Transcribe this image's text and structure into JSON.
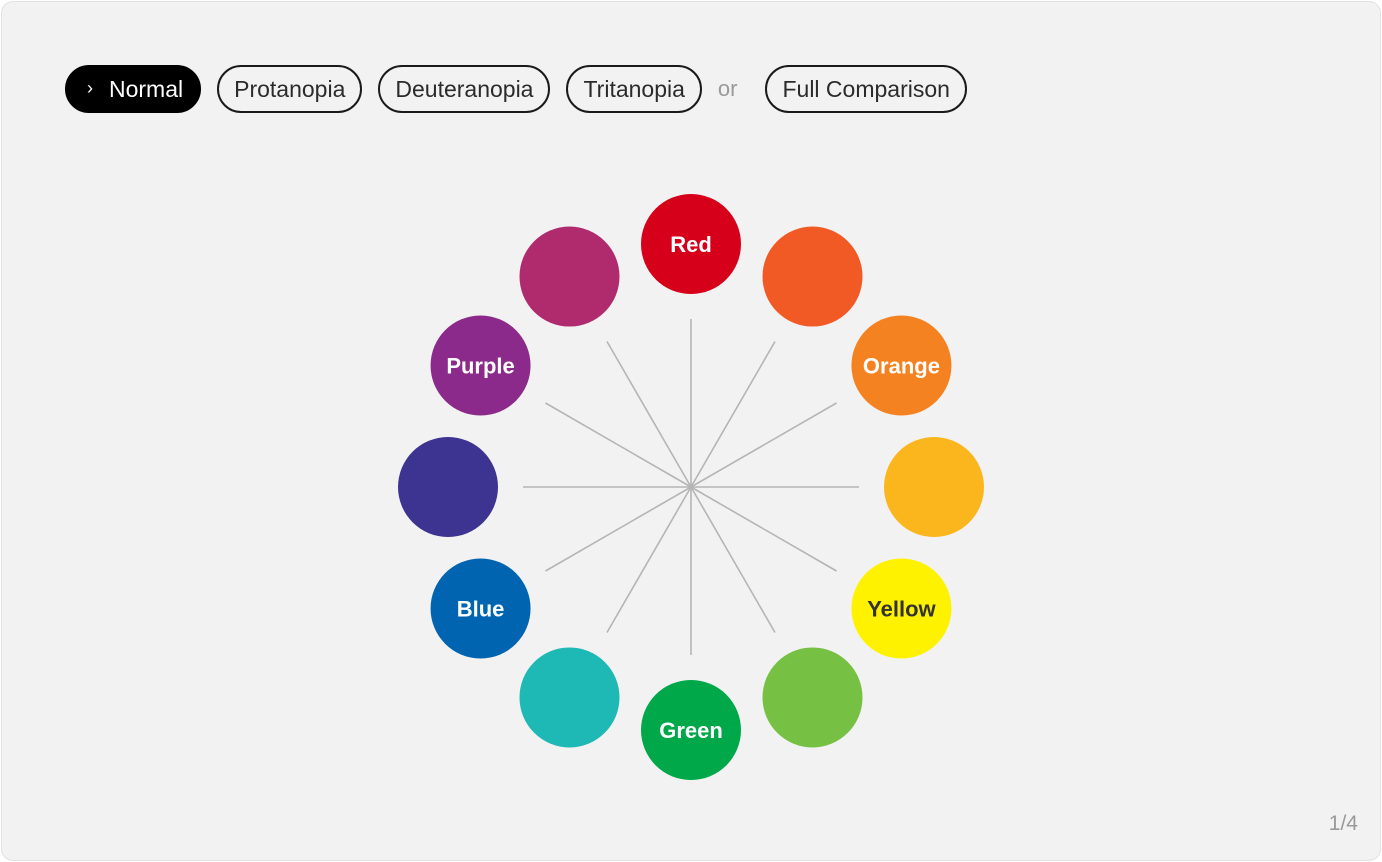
{
  "modes": {
    "buttons": [
      {
        "label": "Normal",
        "active": true
      },
      {
        "label": "Protanopia",
        "active": false
      },
      {
        "label": "Deuteranopia",
        "active": false
      },
      {
        "label": "Tritanopia",
        "active": false
      }
    ],
    "separator": "or",
    "comparison_label": "Full Comparison"
  },
  "wheel": {
    "swatches": [
      {
        "label": "Red",
        "color": "#d7001a",
        "text_color": "#ffffff"
      },
      {
        "label": "",
        "color": "#f15a24",
        "text_color": "#ffffff"
      },
      {
        "label": "Orange",
        "color": "#f58220",
        "text_color": "#ffffff"
      },
      {
        "label": "",
        "color": "#fbb61e",
        "text_color": "#ffffff"
      },
      {
        "label": "Yellow",
        "color": "#fff200",
        "text_color": "#333333"
      },
      {
        "label": "",
        "color": "#76c043",
        "text_color": "#ffffff"
      },
      {
        "label": "Green",
        "color": "#00a849",
        "text_color": "#ffffff"
      },
      {
        "label": "",
        "color": "#1eb8b5",
        "text_color": "#ffffff"
      },
      {
        "label": "Blue",
        "color": "#0064b1",
        "text_color": "#ffffff"
      },
      {
        "label": "",
        "color": "#3c3490",
        "text_color": "#ffffff"
      },
      {
        "label": "Purple",
        "color": "#8b2a8a",
        "text_color": "#ffffff"
      },
      {
        "label": "",
        "color": "#b02b6e",
        "text_color": "#ffffff"
      }
    ],
    "spoke_color": "#b5b5b5"
  },
  "pagination": {
    "text": "1/4"
  },
  "icons": {
    "active_indicator": "chevron-right-icon"
  }
}
